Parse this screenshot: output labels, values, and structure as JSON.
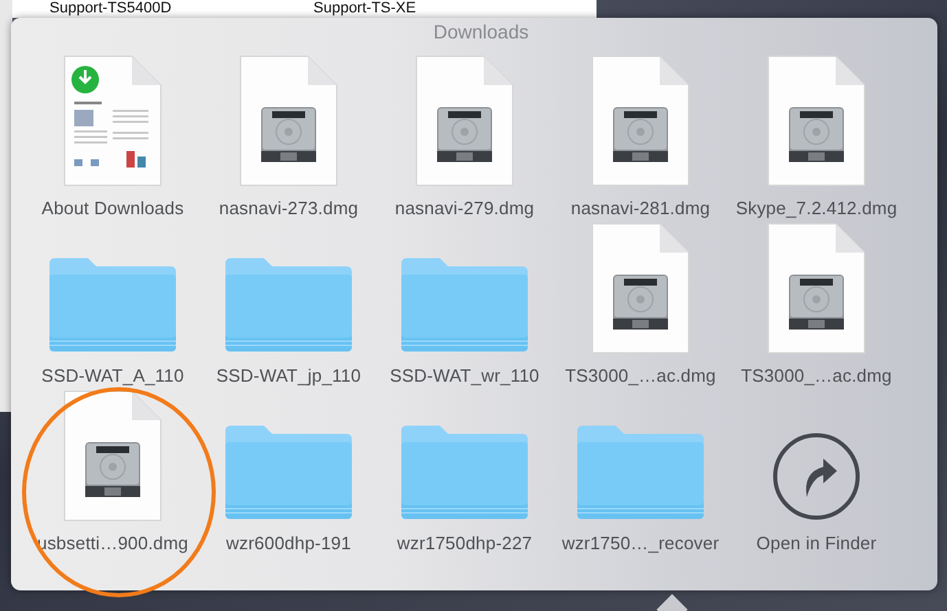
{
  "background_window": {
    "labels": [
      "Support-TS5400D",
      "Support-TS-XE"
    ]
  },
  "popover": {
    "title": "Downloads",
    "items": [
      {
        "kind": "document",
        "label": "About Downloads"
      },
      {
        "kind": "disk-image",
        "label": "nasnavi-273.dmg"
      },
      {
        "kind": "disk-image",
        "label": "nasnavi-279.dmg"
      },
      {
        "kind": "disk-image",
        "label": "nasnavi-281.dmg"
      },
      {
        "kind": "disk-image",
        "label": "Skype_7.2.412.dmg"
      },
      {
        "kind": "folder",
        "label": "SSD-WAT_A_110"
      },
      {
        "kind": "folder",
        "label": "SSD-WAT_jp_110"
      },
      {
        "kind": "folder",
        "label": "SSD-WAT_wr_110"
      },
      {
        "kind": "disk-image",
        "label": "TS3000_…ac.dmg"
      },
      {
        "kind": "disk-image",
        "label": "TS3000_…ac.dmg"
      },
      {
        "kind": "disk-image",
        "label": "usbsetti…900.dmg"
      },
      {
        "kind": "folder",
        "label": "wzr600dhp-191"
      },
      {
        "kind": "folder",
        "label": "wzr1750dhp-227"
      },
      {
        "kind": "folder",
        "label": "wzr1750…_recover"
      },
      {
        "kind": "action",
        "label": "Open in Finder"
      }
    ]
  }
}
